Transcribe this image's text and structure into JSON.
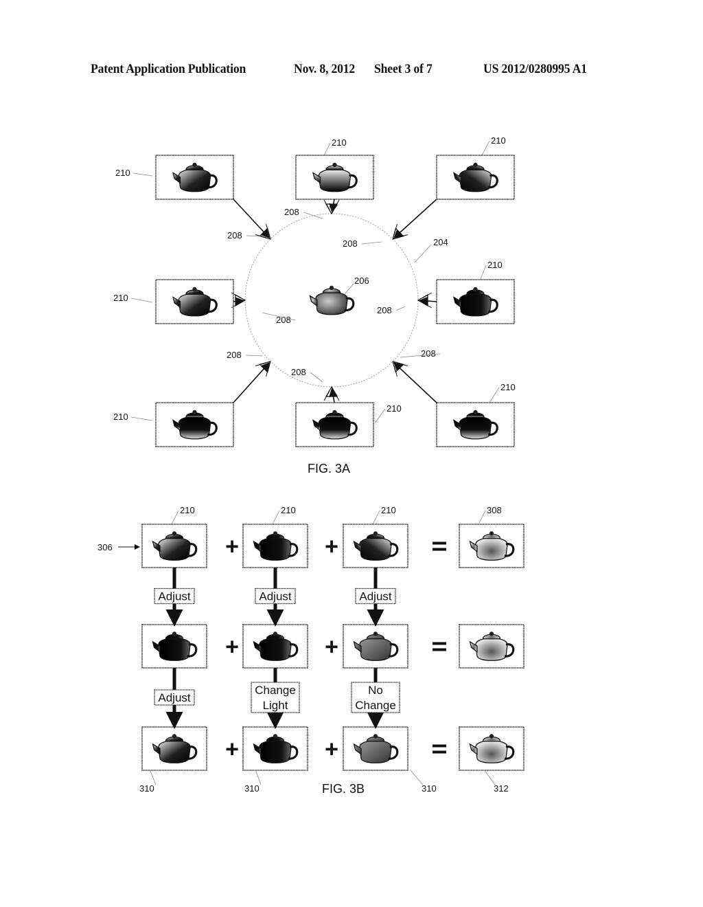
{
  "header": {
    "publication": "Patent Application Publication",
    "date": "Nov. 8, 2012",
    "sheet": "Sheet 3 of 7",
    "number": "US 2012/0280995 A1"
  },
  "fig3a": {
    "caption": "FIG. 3A",
    "circle_label": "204",
    "object_label": "206",
    "camera_label": "208",
    "image_label": "210",
    "images": [
      {
        "position": "top-left",
        "shade": "lit-left",
        "label": "210"
      },
      {
        "position": "top",
        "shade": "lit-top",
        "label": "210"
      },
      {
        "position": "top-right",
        "shade": "lit-right",
        "label": "210"
      },
      {
        "position": "left",
        "shade": "lit-left",
        "label": "210"
      },
      {
        "position": "right",
        "shade": "dark",
        "label": "210"
      },
      {
        "position": "bottom-left",
        "shade": "lit-bottom",
        "label": "210"
      },
      {
        "position": "bottom",
        "shade": "lit-bottom",
        "label": "210"
      },
      {
        "position": "bottom-right",
        "shade": "lit-bottom",
        "label": "210"
      }
    ],
    "cameras": [
      "208",
      "208",
      "208",
      "208",
      "208",
      "208",
      "208",
      "208"
    ]
  },
  "fig3b": {
    "caption": "FIG. 3B",
    "input_label": "306",
    "row1": {
      "labels": [
        "210",
        "210",
        "210"
      ],
      "result_label": "308"
    },
    "row1_ops": [
      "Adjust",
      "Adjust",
      "Adjust"
    ],
    "row2_ops": [
      [
        "Adjust"
      ],
      [
        "Change",
        "Light"
      ],
      [
        "No",
        "Change"
      ]
    ],
    "row3": {
      "labels": [
        "310",
        "310",
        "310"
      ],
      "result_label": "312"
    },
    "plus": "+",
    "equals": "="
  }
}
